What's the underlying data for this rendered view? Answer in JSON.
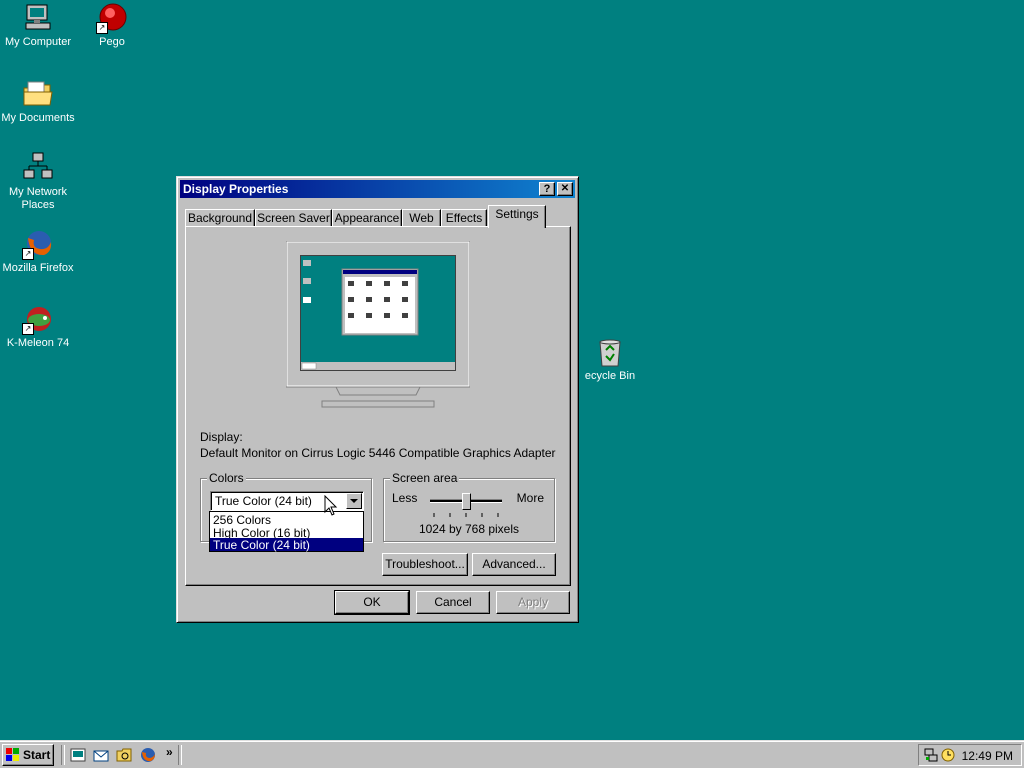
{
  "desktop": {
    "background": "#008080",
    "icons": [
      {
        "label": "My Computer",
        "icon": "computer-icon"
      },
      {
        "label": "Pego",
        "icon": "pego-icon"
      },
      {
        "label": "My Documents",
        "icon": "folder-icon"
      },
      {
        "label": "My Network Places",
        "icon": "network-icon"
      },
      {
        "label": "Mozilla Firefox",
        "icon": "firefox-icon"
      },
      {
        "label": "K-Meleon 74",
        "icon": "kmeleon-icon"
      },
      {
        "label": "ecycle Bin",
        "icon": "recycle-bin-icon"
      }
    ]
  },
  "window": {
    "title": "Display Properties",
    "help_btn": "?",
    "close_btn": "✕",
    "tabs": [
      "Background",
      "Screen Saver",
      "Appearance",
      "Web",
      "Effects",
      "Settings"
    ],
    "active_tab": "Settings",
    "display_label": "Display:",
    "display_value": "Default Monitor on Cirrus Logic 5446 Compatible Graphics Adapter",
    "colors": {
      "legend": "Colors",
      "selected": "True Color (24 bit)",
      "options": [
        "256 Colors",
        "High Color (16 bit)",
        "True Color (24 bit)"
      ],
      "highlighted_index": 2
    },
    "screen_area": {
      "legend": "Screen area",
      "less": "Less",
      "more": "More",
      "value": "1024 by 768 pixels",
      "slider_fraction": 0.5
    },
    "buttons": {
      "troubleshoot": "Troubleshoot...",
      "advanced": "Advanced...",
      "ok": "OK",
      "cancel": "Cancel",
      "apply": "Apply"
    }
  },
  "taskbar": {
    "start_label": "Start",
    "clock": "12:49 PM",
    "chevron": "»"
  }
}
